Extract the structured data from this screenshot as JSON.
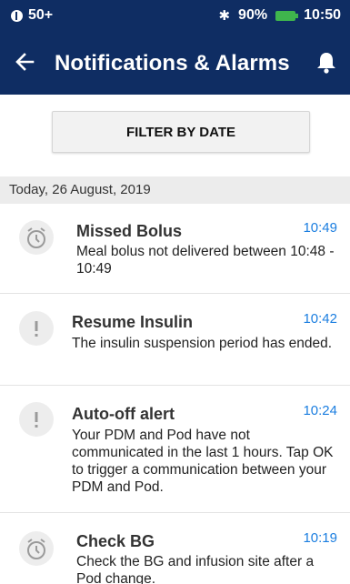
{
  "status_bar": {
    "signal_text": "50+",
    "battery_percent": "90%",
    "time": "10:50"
  },
  "app_bar": {
    "title": "Notifications & Alarms"
  },
  "filter": {
    "label": "FILTER BY DATE"
  },
  "date_header": "Today, 26 August, 2019",
  "notifications": [
    {
      "title": "Missed Bolus",
      "time": "10:49",
      "body": "Meal bolus not delivered between 10:48 - 10:49",
      "icon": "alarm-clock-icon"
    },
    {
      "title": "Resume Insulin",
      "time": "10:42",
      "body": "The insulin suspension period has ended.",
      "icon": "exclamation-icon"
    },
    {
      "title": "Auto-off alert",
      "time": "10:24",
      "body": "Your PDM and Pod have not communicated in the last 1 hours. Tap OK to trigger a communication between your PDM and Pod.",
      "icon": "exclamation-icon"
    },
    {
      "title": "Check BG",
      "time": "10:19",
      "body": "Check the BG and infusion site after a Pod change.",
      "icon": "alarm-clock-icon"
    }
  ],
  "colors": {
    "header_bg": "#0f2d63",
    "time_accent": "#1b7ee0",
    "battery": "#3fb54d"
  }
}
